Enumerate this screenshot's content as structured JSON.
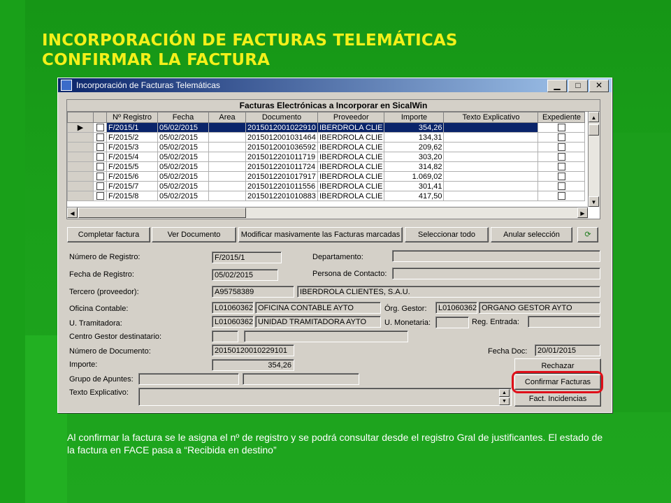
{
  "slide": {
    "title_line1": "INCORPORACIÓN DE FACTURAS TELEMÁTICAS",
    "title_line2": "CONFIRMAR LA FACTURA",
    "caption": "Al confirmar la factura se le asigna el nº de registro y se podrá consultar desde el registro Gral de justificantes. El estado de la factura en FACE pasa a “Recibida en destino”"
  },
  "window": {
    "title": "Incorporación de Facturas Telemáticas",
    "min": "▁",
    "max": "□",
    "close": "✕"
  },
  "grid": {
    "title": "Facturas Electrónicas a Incorporar en SicalWin",
    "headers": [
      "Nº Registro",
      "Fecha",
      "Area",
      "Documento",
      "Proveedor",
      "Importe",
      "Texto Explicativo",
      "Expediente"
    ],
    "rows": [
      {
        "reg": "F/2015/1",
        "fecha": "05/02/2015",
        "area": "",
        "doc": "2015012001022910",
        "prov": "IBERDROLA CLIE",
        "imp": "354,26",
        "texto": ""
      },
      {
        "reg": "F/2015/2",
        "fecha": "05/02/2015",
        "area": "",
        "doc": "2015012001031464",
        "prov": "IBERDROLA CLIE",
        "imp": "134,31",
        "texto": ""
      },
      {
        "reg": "F/2015/3",
        "fecha": "05/02/2015",
        "area": "",
        "doc": "2015012001036592",
        "prov": "IBERDROLA CLIE",
        "imp": "209,62",
        "texto": ""
      },
      {
        "reg": "F/2015/4",
        "fecha": "05/02/2015",
        "area": "",
        "doc": "2015012201011719",
        "prov": "IBERDROLA CLIE",
        "imp": "303,20",
        "texto": ""
      },
      {
        "reg": "F/2015/5",
        "fecha": "05/02/2015",
        "area": "",
        "doc": "2015012201011724",
        "prov": "IBERDROLA CLIE",
        "imp": "314,82",
        "texto": ""
      },
      {
        "reg": "F/2015/6",
        "fecha": "05/02/2015",
        "area": "",
        "doc": "2015012201017917",
        "prov": "IBERDROLA CLIE",
        "imp": "1.069,02",
        "texto": ""
      },
      {
        "reg": "F/2015/7",
        "fecha": "05/02/2015",
        "area": "",
        "doc": "2015012201011556",
        "prov": "IBERDROLA CLIE",
        "imp": "301,41",
        "texto": ""
      },
      {
        "reg": "F/2015/8",
        "fecha": "05/02/2015",
        "area": "",
        "doc": "2015012201010883",
        "prov": "IBERDROLA CLIE",
        "imp": "417,50",
        "texto": ""
      }
    ],
    "selected_row": 0
  },
  "actions": {
    "completar": "Completar factura",
    "ver": "Ver Documento",
    "modificar": "Modificar masivamente las Facturas marcadas",
    "seleccionar": "Seleccionar todo",
    "anular": "Anular selección",
    "refresh_icon": "refresh-icon"
  },
  "form": {
    "num_registro_label": "Número de Registro:",
    "num_registro": "F/2015/1",
    "fecha_registro_label": "Fecha de Registro:",
    "fecha_registro": "05/02/2015",
    "tercero_label": "Tercero (proveedor):",
    "tercero_nif": "A95758389",
    "tercero_nombre": "IBERDROLA CLIENTES, S.A.U.",
    "oficina_label": "Oficina Contable:",
    "oficina_code": "L01060362",
    "oficina_name": "OFICINA CONTABLE AYTO",
    "tramitadora_label": "U. Tramitadora:",
    "tramitadora_code": "L01060362",
    "tramitadora_name": "UNIDAD TRAMITADORA AYTO",
    "centro_label": "Centro Gestor destinatario:",
    "num_doc_label": "Número de Documento:",
    "num_doc": "20150120010229101",
    "importe_label": "Importe:",
    "importe": "354,26",
    "grupo_label": "Grupo de Apuntes:",
    "texto_label": "Texto Explicativo:",
    "departamento_label": "Departamento:",
    "persona_label": "Persona de Contacto:",
    "organo_label": "Órg. Gestor:",
    "organo_code": "L01060362",
    "organo_name": "ORGANO GESTOR AYTO",
    "monetaria_label": "U. Monetaria:",
    "reg_entrada_label": "Reg. Entrada:",
    "fecha_doc_label": "Fecha Doc:",
    "fecha_doc": "20/01/2015"
  },
  "side_buttons": {
    "rechazar": "Rechazar",
    "confirmar": "Confirmar Facturas",
    "incidencias": "Fact. Incidencias"
  },
  "colors": {
    "title": "#f3f01a",
    "selection": "#0a246a",
    "highlight": "#e0101a"
  }
}
